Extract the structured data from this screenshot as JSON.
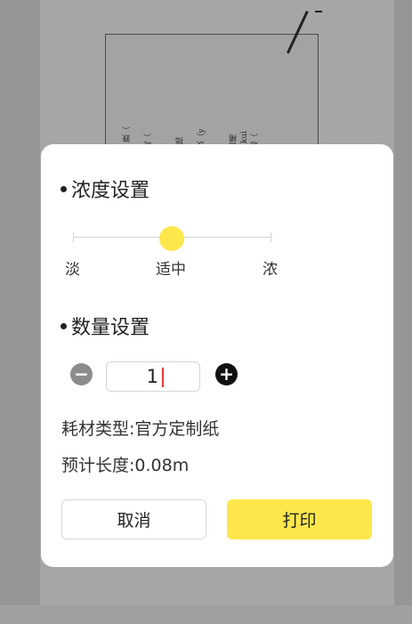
{
  "preview": {
    "lines": [
      "17.",
      "A. 噴（chēn）怪 跌（",
      "斧凿处（chù）忧",
      "C. 罐隔（yì）翩跹（",
      "（xióng）扒行李",
      "18.",
      "A. 绕帧（zhēn）拙",
      "封架朗（yīn）子",
      "C. 瞄（mù）劳 饮（y",
      "瓢（wān）绿瓜",
      "19.",
      "A. 连（kǎi）怜 懒稀",
      "n) 疾 功亏一 篑（kuì",
      "C. 腼腆（chǔ）遮（",
      "背衣肝（gàn）食"
    ]
  },
  "modal": {
    "concentration": {
      "title": "浓度设置",
      "levels": [
        "淡",
        "适中",
        "浓"
      ],
      "selected_level": 1
    },
    "quantity": {
      "title": "数量设置",
      "minus_icon": "minus-circle-icon",
      "plus_icon": "plus-circle-icon",
      "minus_symbol": "−",
      "plus_symbol": "+",
      "value": "1"
    },
    "material_type": "耗材类型:官方定制纸",
    "estimated_length": "预计长度:0.08m",
    "buttons": {
      "cancel": "取消",
      "print": "打印"
    },
    "colors": {
      "accent": "#fde74c",
      "caret": "#e23a3a",
      "overlay": "#969696"
    }
  }
}
